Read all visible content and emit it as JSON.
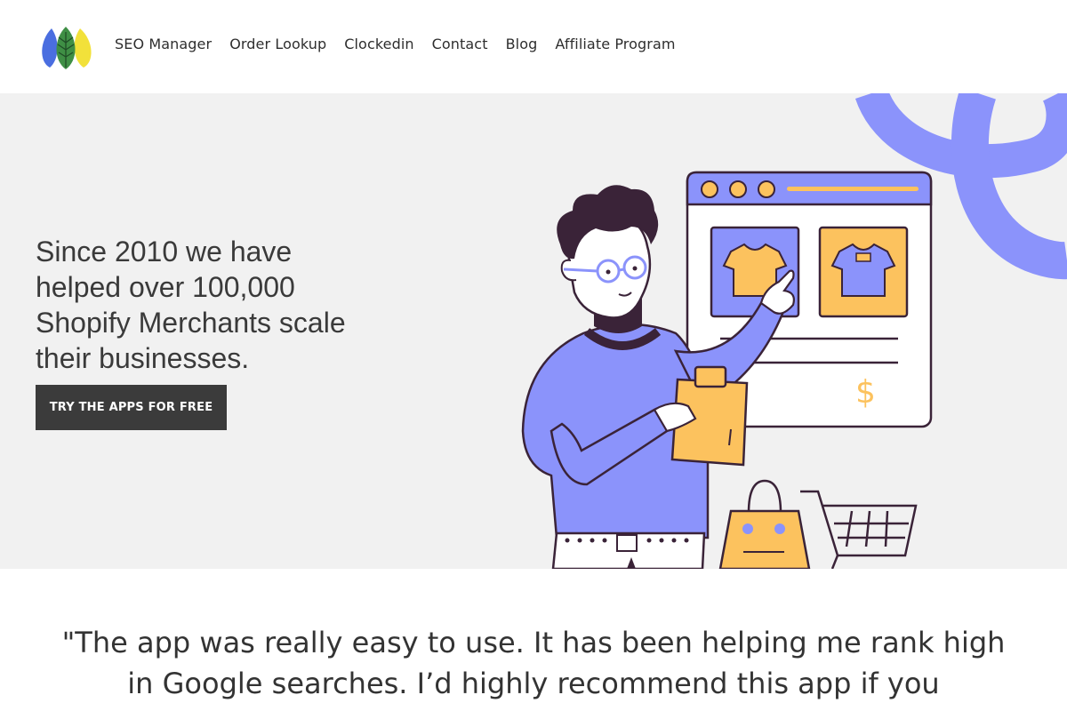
{
  "header": {
    "nav": [
      {
        "label": "SEO Manager"
      },
      {
        "label": "Order Lookup"
      },
      {
        "label": "Clockedin"
      },
      {
        "label": "Contact"
      },
      {
        "label": "Blog"
      },
      {
        "label": "Affiliate Program"
      }
    ]
  },
  "hero": {
    "title": "Since 2010 we have helped over 100,000 Shopify Merchants scale their businesses.",
    "cta_label": "TRY THE APPS FOR FREE",
    "illustration": {
      "icon": "shopping-person-illustration",
      "currency_symbol": "$"
    }
  },
  "testimonial": {
    "text": "\"The app was really easy to use. It has been helping me rank high in Google searches. I’d highly recommend this app if you"
  },
  "colors": {
    "accent_purple": "#8b93fb",
    "accent_yellow": "#fcc25e",
    "outline_dark": "#3a2338",
    "button_bg": "#3b3b3b",
    "hero_bg": "#f1f1f1"
  }
}
